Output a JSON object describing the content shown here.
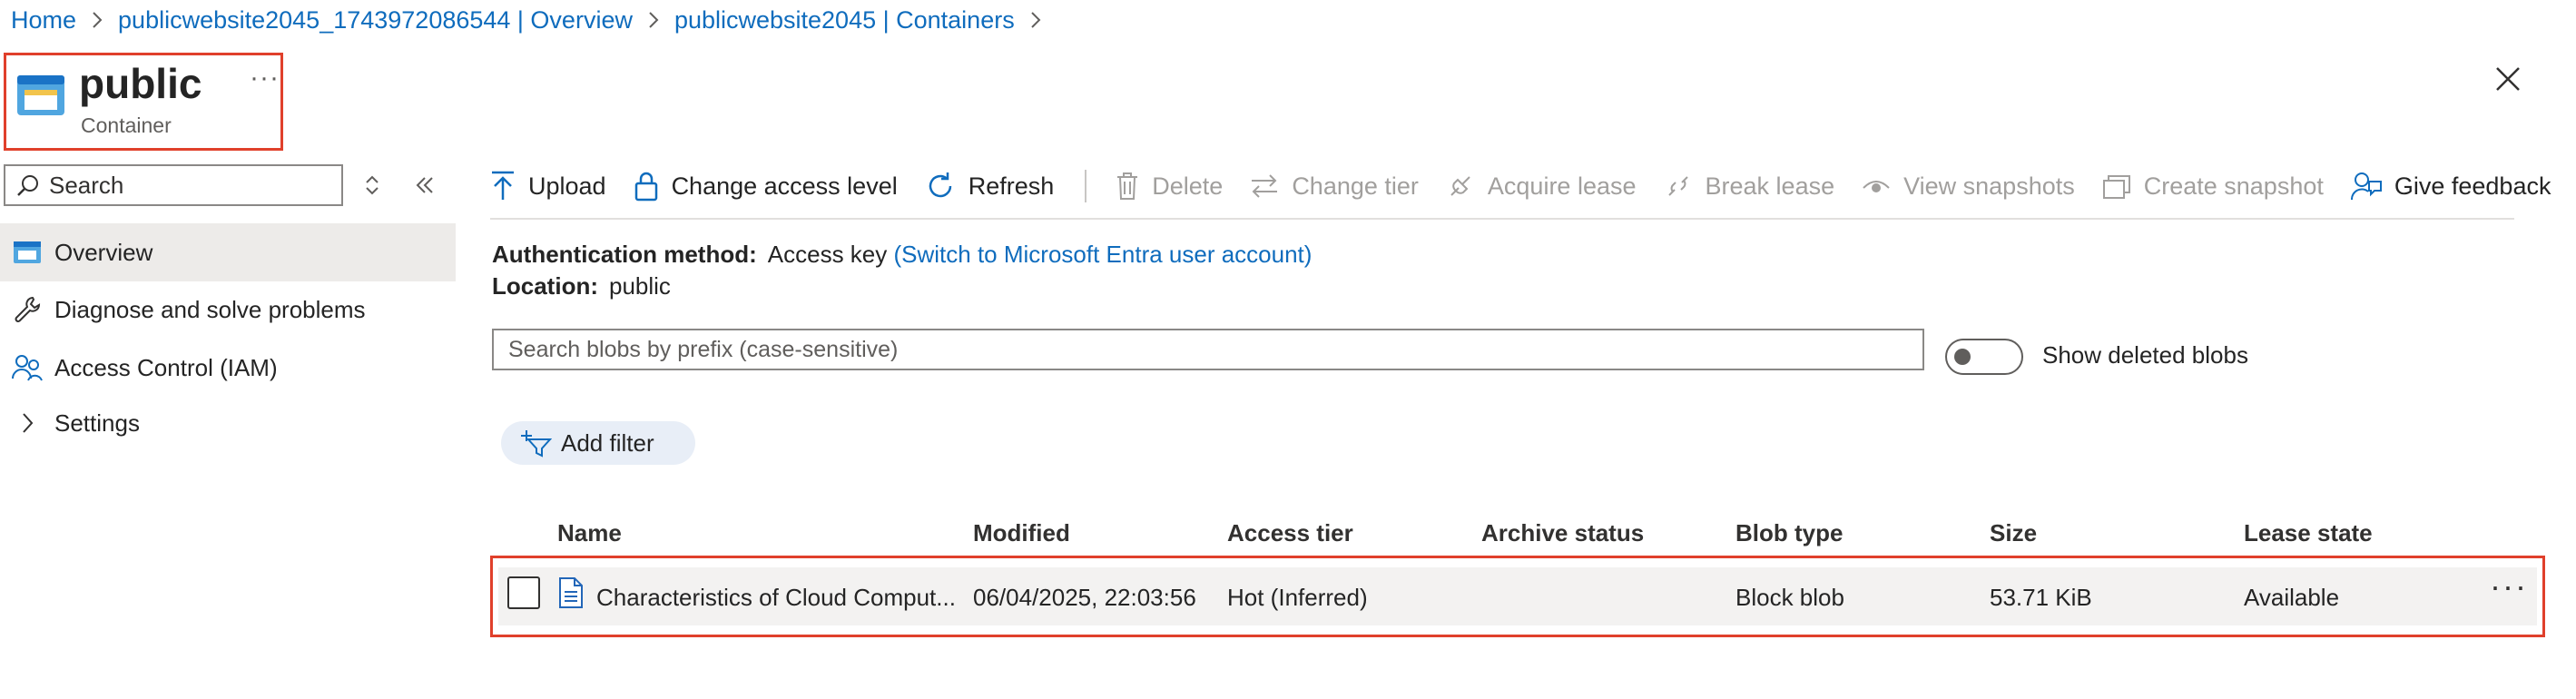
{
  "breadcrumb": {
    "items": [
      "Home",
      "publicwebsite2045_1743972086544 | Overview",
      "publicwebsite2045 | Containers"
    ]
  },
  "header": {
    "title": "public",
    "subtitle": "Container",
    "more": "···",
    "icon": "container-icon"
  },
  "sidebar": {
    "search_placeholder": "Search",
    "items": [
      {
        "label": "Overview",
        "icon": "overview-icon",
        "selected": true
      },
      {
        "label": "Diagnose and solve problems",
        "icon": "wrench-icon"
      },
      {
        "label": "Access Control (IAM)",
        "icon": "people-icon"
      },
      {
        "label": "Settings",
        "icon": "chevron-right-icon"
      }
    ]
  },
  "toolbar": {
    "upload": "Upload",
    "change_access": "Change access level",
    "refresh": "Refresh",
    "delete": "Delete",
    "change_tier": "Change tier",
    "acquire_lease": "Acquire lease",
    "break_lease": "Break lease",
    "view_snapshots": "View snapshots",
    "create_snapshot": "Create snapshot",
    "feedback": "Give feedback"
  },
  "info": {
    "auth_label": "Authentication method:",
    "auth_value": "Access key",
    "auth_link": "(Switch to Microsoft Entra user account)",
    "location_label": "Location:",
    "location_value": "public"
  },
  "search": {
    "placeholder": "Search blobs by prefix (case-sensitive)"
  },
  "toggle": {
    "label": "Show deleted blobs",
    "on": false
  },
  "filter": {
    "label": "Add filter"
  },
  "table": {
    "headers": [
      "Name",
      "Modified",
      "Access tier",
      "Archive status",
      "Blob type",
      "Size",
      "Lease state"
    ],
    "rows": [
      {
        "name": "Characteristics of Cloud Comput...",
        "modified": "06/04/2025, 22:03:56",
        "access_tier": "Hot (Inferred)",
        "archive_status": "",
        "blob_type": "Block blob",
        "size": "53.71 KiB",
        "lease_state": "Available",
        "more": "···"
      }
    ]
  },
  "colors": {
    "accent": "#0f6cbd",
    "highlight": "#e0402b",
    "selected_bg": "#edebe9"
  }
}
